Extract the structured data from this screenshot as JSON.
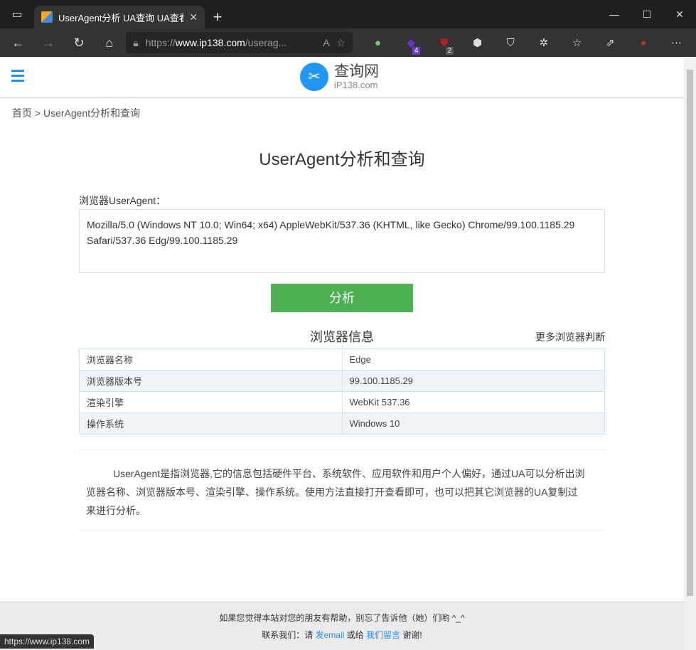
{
  "browser": {
    "tab_title": "UserAgent分析 UA查询 UA查看",
    "url_prefix": "https://",
    "url_host": "www.ip138.com",
    "url_rest": "/userag...",
    "ext_badge_1": "4",
    "ext_badge_2": "2",
    "status_url": "https://www.ip138.com"
  },
  "site": {
    "logo_name": "查询网",
    "logo_domain": "iP138.com",
    "breadcrumb": "首页 > UserAgent分析和查询",
    "title": "UserAgent分析和查询"
  },
  "form": {
    "label": "浏览器UserAgent：",
    "value": "Mozilla/5.0 (Windows NT 10.0; Win64; x64) AppleWebKit/537.36 (KHTML, like Gecko) Chrome/99.100.1185.29 Safari/537.36 Edg/99.100.1185.29",
    "button": "分析"
  },
  "info": {
    "title": "浏览器信息",
    "more": "更多浏览器判断",
    "rows": [
      [
        "浏览器名称",
        "Edge"
      ],
      [
        "浏览器版本号",
        "99.100.1185.29"
      ],
      [
        "渲染引擎",
        "WebKit 537.36"
      ],
      [
        "操作系统",
        "Windows 10"
      ]
    ]
  },
  "description": "UserAgent是指浏览器,它的信息包括硬件平台、系统软件、应用软件和用户个人偏好，通过UA可以分析出浏览器名称、浏览器版本号、渲染引擎、操作系统。使用方法直接打开查看即可，也可以把其它浏览器的UA复制过来进行分析。",
  "footer": {
    "line1": "如果您觉得本站对您的朋友有帮助，别忘了告诉他（她）们哟 ^_^",
    "contact": "联系我们：请",
    "email": "发email",
    "or": "或给",
    "message": "我们留言",
    "thanks": "谢谢!"
  }
}
